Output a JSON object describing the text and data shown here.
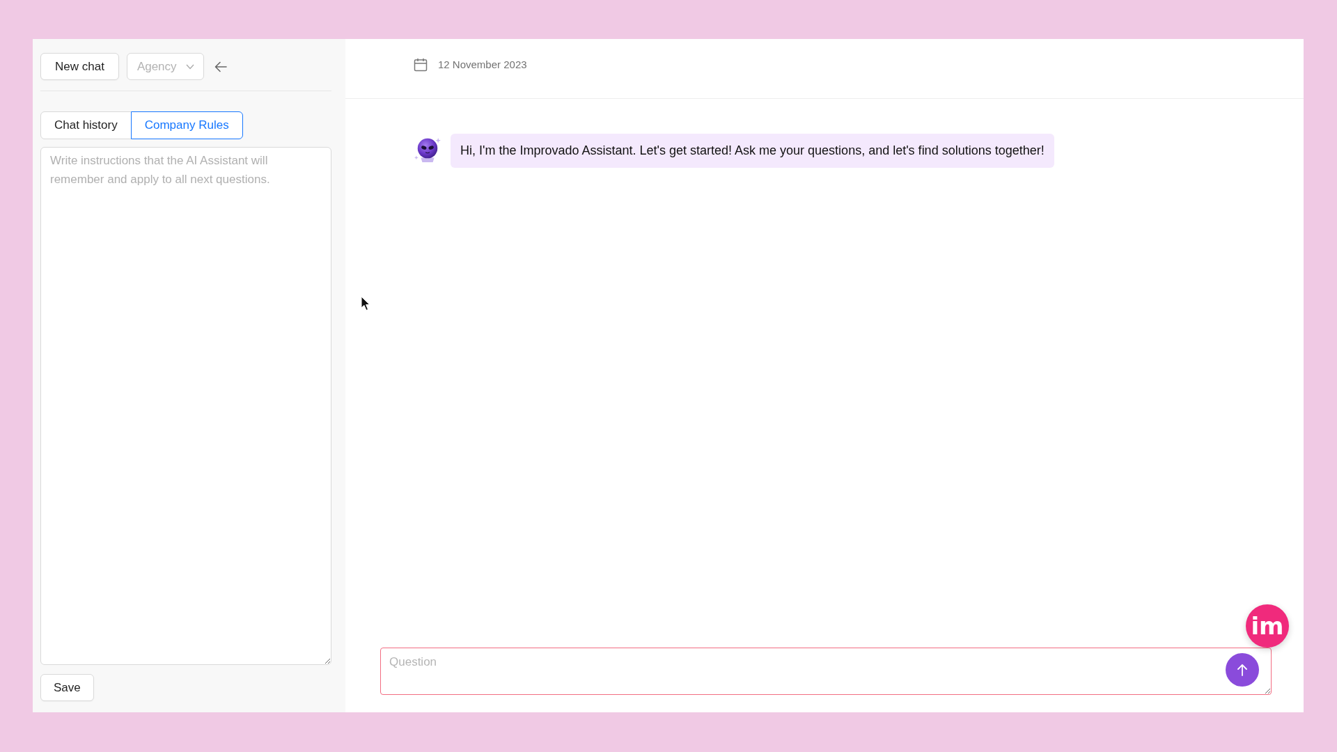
{
  "sidebar": {
    "new_chat_button": "New chat",
    "workspace_select": {
      "value": "Agency",
      "disabled": true
    },
    "tabs": [
      {
        "label": "Chat history",
        "selected": false
      },
      {
        "label": "Company Rules",
        "selected": true
      }
    ],
    "rules_field": {
      "placeholder": "Write instructions that the AI Assistant will remember and apply to all next questions."
    },
    "save_button": "Save"
  },
  "chat": {
    "date": "12 November 2023",
    "messages": [
      {
        "kind": "assistant",
        "text": "Hi, I'm the Improvado Assistant. Let's get started! Ask me your questions, and let's find solutions together!"
      }
    ],
    "question_field": {
      "placeholder": "Question"
    },
    "logo_badge": "im"
  }
}
